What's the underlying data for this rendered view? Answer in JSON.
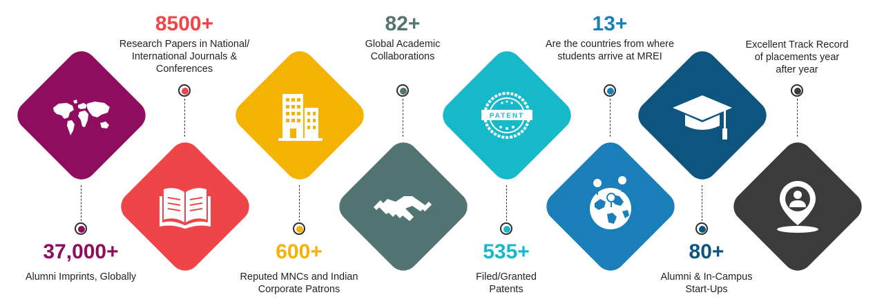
{
  "colors": {
    "purple": "#8e0d5f",
    "red": "#ef4448",
    "yellow": "#f4b300",
    "slate": "#527473",
    "cyan": "#15b9c9",
    "blue": "#1a7fb9",
    "navy": "#0d557f",
    "charcoal": "#3b3b3b"
  },
  "stats": [
    {
      "number": "37,000+",
      "label": "Alumni Imprints, Globally"
    },
    {
      "number": "8500+",
      "label_lines": [
        "Research Papers in National/",
        "International Journals &",
        "Conferences"
      ]
    },
    {
      "number": "600+",
      "label_lines": [
        "Reputed MNCs and Indian",
        "Corporate Patrons"
      ]
    },
    {
      "number": "82+",
      "label_lines": [
        "Global Academic",
        "Collaborations"
      ]
    },
    {
      "number": "535+",
      "label_lines": [
        "Filed/Granted",
        "Patents"
      ]
    },
    {
      "number": "13+",
      "label_lines": [
        "Are the countries from where",
        "students arrive at MREI"
      ]
    },
    {
      "number": "80+",
      "label_lines": [
        "Alumni & In-Campus",
        "Start-Ups"
      ]
    },
    {
      "number": "",
      "label_lines": [
        "Excellent Track Record",
        "of placements year",
        "after year"
      ]
    }
  ],
  "patent_stamp_text": "PATENT",
  "icons": [
    "world-map-icon",
    "open-book-icon",
    "buildings-icon",
    "handshake-icon",
    "patent-stamp-icon",
    "globe-pins-icon",
    "graduation-cap-icon",
    "location-person-icon"
  ]
}
